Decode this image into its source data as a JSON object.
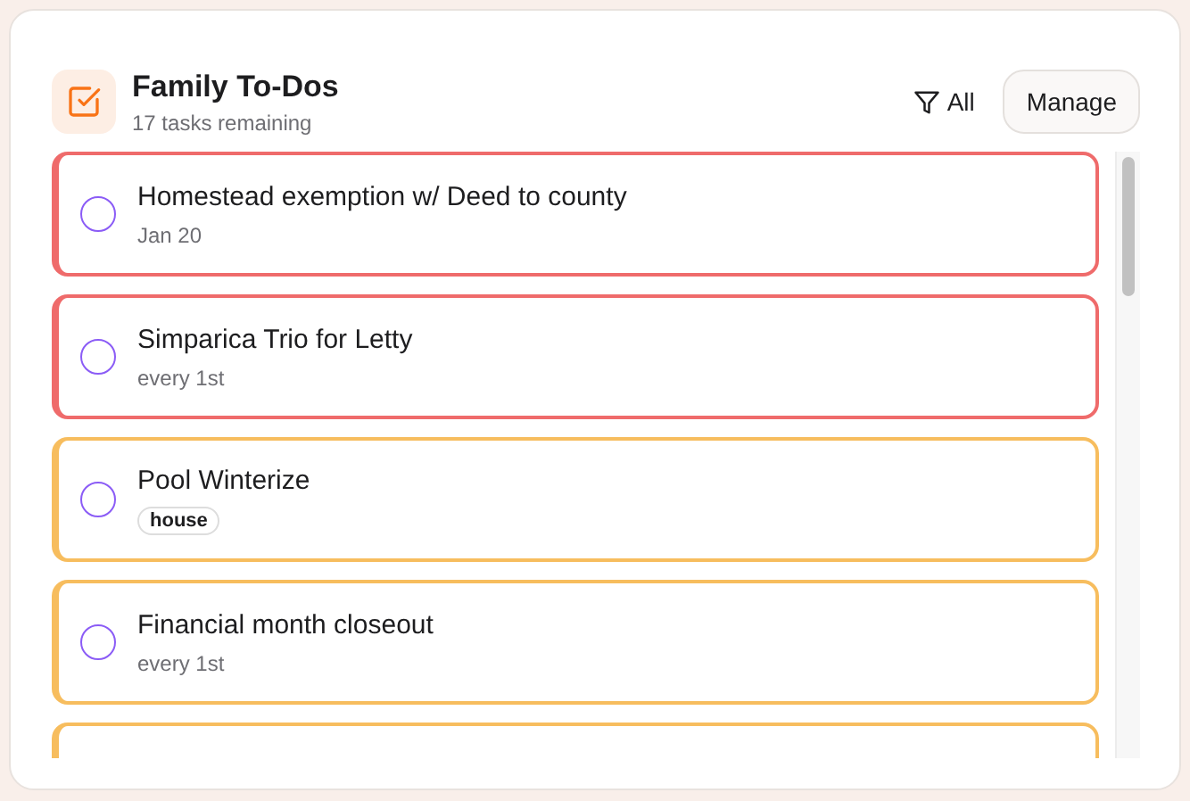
{
  "header": {
    "title": "Family To-Dos",
    "subtitle": "17 tasks remaining",
    "filter": "All",
    "manage_button": "Manage"
  },
  "tasks": [
    {
      "title": "Homestead exemption w/ Deed to county",
      "meta": "Jan 20",
      "color": "#ef6b6b",
      "checked": false
    },
    {
      "title": "Simparica Trio for Letty",
      "meta": "every 1st",
      "color": "#ef6b6b",
      "checked": false
    },
    {
      "title": "Pool Winterize",
      "tag": "house",
      "color": "#f7bd5e",
      "checked": false
    },
    {
      "title": "Financial month closeout",
      "meta": "every 1st",
      "color": "#f7bd5e",
      "checked": false
    },
    {
      "color": "#f7bd5e"
    }
  ]
}
